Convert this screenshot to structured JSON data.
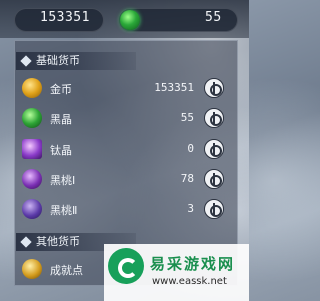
{
  "top_bar": {
    "gold_value": "153351",
    "dark_crystal_value": "55",
    "gold_icon": "coin-icon",
    "dark_icon": "green-gem-icon"
  },
  "basic_currency": {
    "title": "基础货币",
    "rows": [
      {
        "label": "金币",
        "value": "153351",
        "icon": "gold-coin-icon"
      },
      {
        "label": "黑晶",
        "value": "55",
        "icon": "green-crystal-icon"
      },
      {
        "label": "钛晶",
        "value": "0",
        "icon": "titanium-crystal-icon"
      },
      {
        "label": "黑桃Ⅰ",
        "value": "78",
        "icon": "spade-one-icon"
      },
      {
        "label": "黑桃Ⅱ",
        "value": "3",
        "icon": "spade-two-icon"
      }
    ]
  },
  "other_currency": {
    "title": "其他货币",
    "rows": [
      {
        "label": "成就点",
        "icon": "achievement-icon"
      }
    ]
  },
  "watermark": {
    "name": "易采游戏网",
    "url": "www.eassk.net"
  },
  "colors": {
    "panel_bg": "#3c4454",
    "accent_green": "#1a8f4e",
    "text": "#e9eef5"
  }
}
